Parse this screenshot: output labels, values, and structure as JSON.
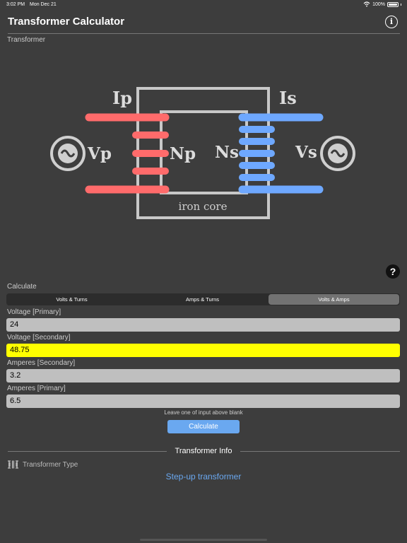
{
  "status": {
    "time": "3:02 PM",
    "date": "Mon Dec 21",
    "battery": "100%"
  },
  "header": {
    "title": "Transformer Calculator"
  },
  "section_label": "Transformer",
  "diagram": {
    "ip": "Ip",
    "is": "Is",
    "vp": "Vp",
    "vs": "Vs",
    "np": "Np",
    "ns": "Ns",
    "core": "iron core",
    "primary_color": "#ff6b6b",
    "secondary_color": "#6ea8ff"
  },
  "help": "?",
  "calculate": {
    "label": "Calculate",
    "tabs": [
      "Volts & Turns",
      "Amps & Turns",
      "Volts & Amps"
    ],
    "selected_tab": "Volts & Amps"
  },
  "fields": [
    {
      "label": "Voltage [Primary]",
      "value": "24"
    },
    {
      "label": "Voltage [Secondary]",
      "value": "48.75"
    },
    {
      "label": "Amperes [Secondary]",
      "value": "3.2"
    },
    {
      "label": "Amperes [Primary]",
      "value": "6.5"
    }
  ],
  "hint": "Leave one of input above blank",
  "calc_button": "Calculate",
  "info": {
    "title": "Transformer Info",
    "type_label": "Transformer Type",
    "type_value": "Step-up transformer"
  }
}
